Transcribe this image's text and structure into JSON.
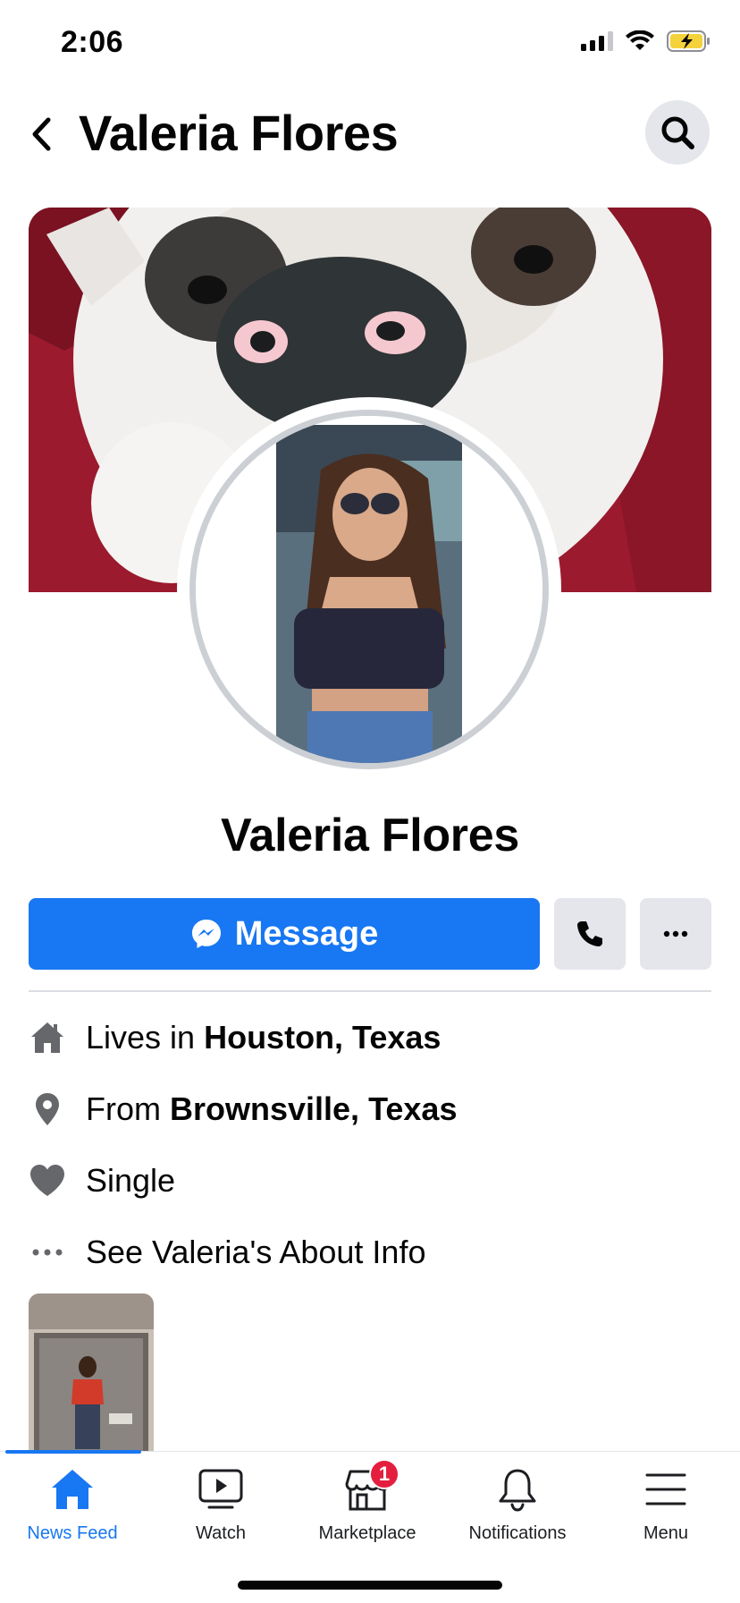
{
  "status_bar": {
    "time": "2:06"
  },
  "header": {
    "title": "Valeria Flores"
  },
  "cover_photo": {
    "subject": "dog close-up"
  },
  "profile": {
    "photo_subject": "woman in sunglasses in car",
    "name": "Valeria Flores"
  },
  "actions": {
    "message_label": "Message"
  },
  "info": {
    "lives_prefix": "Lives in ",
    "lives_place": "Houston, Texas",
    "from_prefix": "From ",
    "from_place": "Brownsville, Texas",
    "relationship": "Single",
    "about_link": "See Valeria's About Info"
  },
  "tabs": [
    {
      "label": "News Feed",
      "icon": "home-icon",
      "active": true
    },
    {
      "label": "Watch",
      "icon": "watch-icon"
    },
    {
      "label": "Marketplace",
      "icon": "marketplace-icon",
      "badge": "1"
    },
    {
      "label": "Notifications",
      "icon": "bell-icon"
    },
    {
      "label": "Menu",
      "icon": "menu-icon"
    }
  ],
  "colors": {
    "accent": "#1877f2",
    "button_gray": "#e4e6eb",
    "badge_red": "#e41e3f",
    "icon_gray": "#65676b"
  }
}
